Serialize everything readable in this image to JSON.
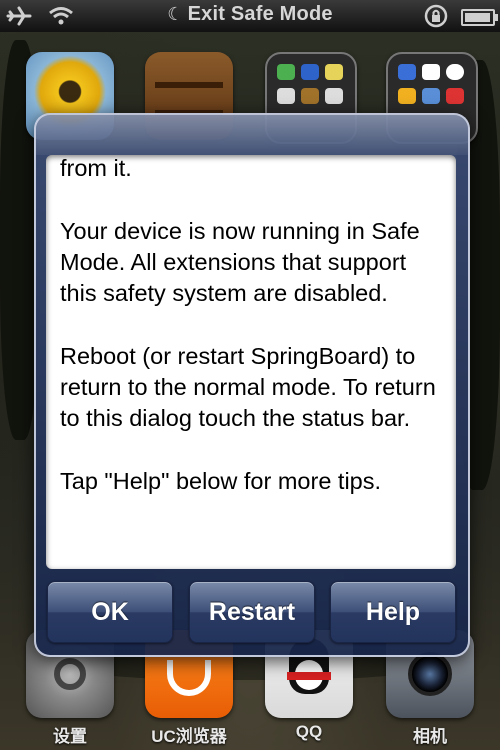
{
  "status_bar": {
    "title": "Exit Safe Mode",
    "icons": [
      "airplane-icon",
      "wifi-icon",
      "moon-icon",
      "rotation-lock-icon",
      "battery-icon"
    ]
  },
  "home_apps": {
    "row1": [
      {
        "icon": "sunflower-photos-icon",
        "label": ""
      },
      {
        "icon": "bookshelf-icon",
        "label": ""
      },
      {
        "icon": "app-folder-icon",
        "label": ""
      },
      {
        "icon": "calendar-folder-icon",
        "label": ""
      }
    ],
    "dock": [
      {
        "icon": "settings-gear-icon",
        "label": "设置"
      },
      {
        "icon": "uc-browser-icon",
        "label": "UC浏览器"
      },
      {
        "icon": "qq-penguin-icon",
        "label": "QQ"
      },
      {
        "icon": "camera-icon",
        "label": "相机"
      }
    ]
  },
  "dialog": {
    "paragraphs": [
      "from it.",
      "Your device is now running in Safe Mode. All extensions that support this safety system are disabled.",
      "Reboot (or restart SpringBoard) to return to the normal mode. To return to this dialog touch the status bar.",
      "Tap \"Help\" below for more tips."
    ],
    "buttons": {
      "ok": "OK",
      "restart": "Restart",
      "help": "Help"
    }
  },
  "colors": {
    "dialog_blue": "#24365f",
    "button_blue": "#3d4f78",
    "status_bar": "#1a1a1a"
  }
}
